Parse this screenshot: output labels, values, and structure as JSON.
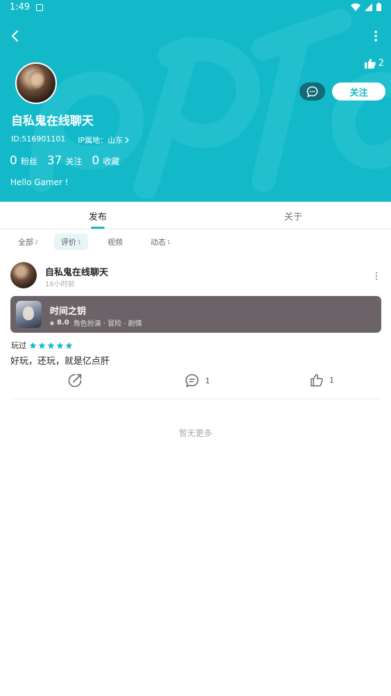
{
  "status_bar": {
    "time": "1:49"
  },
  "header": {
    "like_count": "2",
    "follow_label": "关注",
    "username": "自私鬼在线聊天",
    "id_text": "ID:516901101",
    "ip_label": "IP属地：山东",
    "stats": [
      {
        "num": "0",
        "label": "粉丝"
      },
      {
        "num": "37",
        "label": "关注"
      },
      {
        "num": "0",
        "label": "收藏"
      }
    ],
    "bio": "Hello Gamer !",
    "colors": {
      "background": "#14b9c9",
      "message_button": "#136a79"
    }
  },
  "tabs": [
    {
      "label": "发布",
      "active": true
    },
    {
      "label": "关于",
      "active": false
    }
  ],
  "filters": [
    {
      "label": "全部",
      "count": "2",
      "active": false
    },
    {
      "label": "评价",
      "count": "1",
      "active": true
    },
    {
      "label": "视频",
      "count": "",
      "active": false
    },
    {
      "label": "动态",
      "count": "1",
      "active": false
    }
  ],
  "post": {
    "author": "自私鬼在线聊天",
    "time": "16小时前",
    "game": {
      "title": "时间之钥",
      "score": "8.0",
      "tags": "角色扮演 · 冒险 · 剧情"
    },
    "played_label": "玩过",
    "rating_stars": 5,
    "text": "好玩，还玩，就是亿点肝",
    "comment_count": "1",
    "like_count": "1"
  },
  "footer": {
    "no_more": "暂无更多"
  },
  "icons": [
    "back-icon",
    "more-vertical-icon",
    "thumb-up-icon",
    "message-bubble-icon",
    "chevron-right-icon",
    "share-icon",
    "comment-icon",
    "star-icon"
  ]
}
